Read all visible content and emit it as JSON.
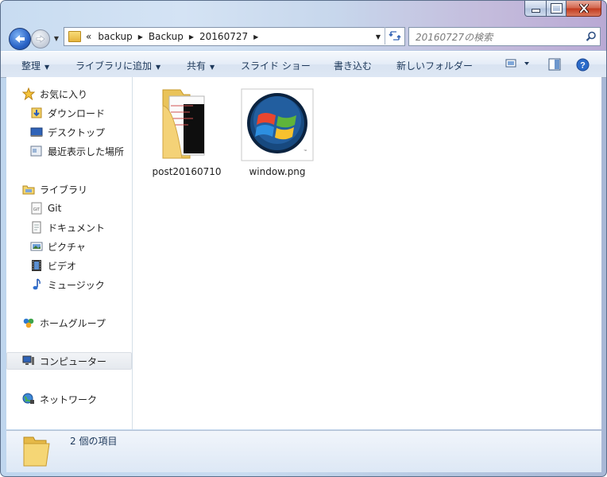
{
  "window": {
    "caption": {
      "minimize": "minimize",
      "maximize": "maximize",
      "close": "close"
    }
  },
  "address": {
    "overflow": "«",
    "crumbs": [
      "backup",
      "Backup",
      "20160727"
    ]
  },
  "search": {
    "placeholder": "20160727の検索"
  },
  "toolbar": {
    "organize": "整理",
    "add_to_library": "ライブラリに追加",
    "share": "共有",
    "slideshow": "スライド ショー",
    "burn": "書き込む",
    "new_folder": "新しいフォルダー"
  },
  "sidebar": {
    "favorites": "お気に入り",
    "downloads": "ダウンロード",
    "desktop": "デスクトップ",
    "recent": "最近表示した場所",
    "libraries": "ライブラリ",
    "git": "Git",
    "documents": "ドキュメント",
    "pictures": "ピクチャ",
    "videos": "ビデオ",
    "music": "ミュージック",
    "homegroup": "ホームグループ",
    "computer": "コンピューター",
    "network": "ネットワーク"
  },
  "files": [
    {
      "name": "post20160710",
      "type": "folder"
    },
    {
      "name": "window.png",
      "type": "image"
    }
  ],
  "status": {
    "count": "2 個の項目"
  },
  "colors": {
    "accent": "#1e395b",
    "selection": "#e5e9ee"
  }
}
